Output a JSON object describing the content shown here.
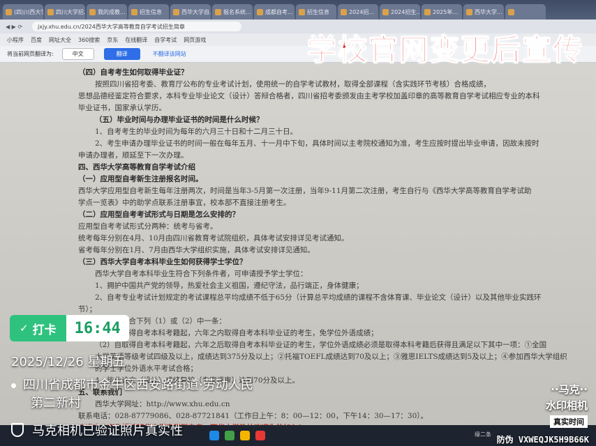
{
  "browser": {
    "tabs": [
      "(四)川西大学",
      "四川大学招...",
      "我的成教...",
      "招生信息",
      "西华大学自...",
      "报名系统...",
      "成都自考...",
      "招生信息",
      "2024招...",
      "2024招生...",
      "2025年...",
      "西华大学...",
      ""
    ],
    "url": "jxjy.xhu.edu.cn/2024西华大学高等教育自学考试招生简章",
    "bookmarks": [
      "小程序",
      "百度",
      "网址大全",
      "360搜索",
      "京东",
      "在线翻译",
      "自学考试",
      "网页游戏"
    ]
  },
  "translate_bar": {
    "label": "将当前网页翻译为:",
    "lang": "中文",
    "button": "翻译",
    "link": "不翻译该网站"
  },
  "overlay": {
    "headline": "学校官网变更后宣传",
    "checkin_label": "打卡",
    "time": "16:44",
    "date": "2025/12/26  星期五",
    "location_line1": "四川省成都市金牛区西安路街道·劳动人民",
    "location_line2": "第二新村",
    "verify": "马克相机已验证照片真实性",
    "watermark_line1": "··马克··",
    "watermark_line2": "水印相机",
    "watermark_badge": "真实时间",
    "anti_fake": "防伪 VXWEQJK5H9B66K"
  },
  "document": {
    "lines": [
      {
        "t": "（四）自考考生如何取得毕业证？",
        "c": "h"
      },
      {
        "t": "按照四川省招考委、教育厅公布的专业考试计划，使用统一的自学考试教材，取得全部课程（含实践环节考核）合格成绩，",
        "c": "ind"
      },
      {
        "t": "思想品德经鉴定符合要求，本科专业毕业论文（设计）答辩合格者，四川省招考委颁发由主考学校加盖印章的高等教育自学考试相应专业的本科",
        "c": ""
      },
      {
        "t": "毕业证书，国家承认学历。",
        "c": ""
      },
      {
        "t": "（五）毕业时间与办理毕业证书的时间是什么时候？",
        "c": "h ind"
      },
      {
        "t": "1、自考考生的毕业时间为每年的六月三十日和十二月三十日。",
        "c": "ind"
      },
      {
        "t": "2、考生申请办理毕业证书的时间一般在每年五月、十一月中下旬，具体时间以主考院校通知为准，考生应按时提出毕业申请，因故未按时",
        "c": "ind"
      },
      {
        "t": "申请办理者，顺延至下一次办理。",
        "c": ""
      },
      {
        "t": "四、西华大学高等教育自学考试介绍",
        "c": "h"
      },
      {
        "t": "（一）应用型自考新生注册报名时间。",
        "c": "h"
      },
      {
        "t": "西华大学应用型自考新生每年注册两次，时间是当年3-5月第一次注册，当年9-11月第二次注册，考生自行与《西华大学高等教育自学考试助",
        "c": ""
      },
      {
        "t": "学点一览表》中的助学点联系注册事宜，校本部不直接注册考生。",
        "c": ""
      },
      {
        "t": "（二）应用型自考考试形式与日期是怎么安排的？",
        "c": "h"
      },
      {
        "t": "应用型自考考试形式分两种：统考与省考。",
        "c": ""
      },
      {
        "t": "统考每年分别在4月、10月由四川省教育考试院组织，具体考试安排详见考试通知。",
        "c": ""
      },
      {
        "t": "省考每年分别在1月、7月由西华大学组织实施，具体考试安排详见通知。",
        "c": ""
      },
      {
        "t": "（三）西华大学自考本科毕业生如何获得学士学位？",
        "c": "h"
      },
      {
        "t": "西华大学自考本科毕业生符合下列条件者，可申请授予学士学位：",
        "c": "ind"
      },
      {
        "t": "1、拥护中国共产党的领导，热爱社会主义祖国，遵纪守法，品行端正，身体健康；",
        "c": "ind"
      },
      {
        "t": "2、自考专业考试计划规定的考试课程总平均成绩不低于65分（计算总平均成绩的课程不含体育课、毕业论文（设计）以及其他毕业实践环",
        "c": "ind"
      },
      {
        "t": "节）；",
        "c": ""
      },
      {
        "t": "3、必须符合下列（1）或（2）中一条：",
        "c": "ind"
      },
      {
        "t": "（1）自取得自考本科考籍起，六年之内取得自考本科毕业证的考生，免学位外语成绩；",
        "c": "ind"
      },
      {
        "t": "（2）自取得自考本科考籍起，六年之后取得自考本科毕业证的考生，学位外语成绩必须是取得本科考籍后获得且满足以下其中一项：①全国",
        "c": "ind"
      },
      {
        "t": "大学英语等级考试四级及以上，成绩达到375分及以上；②托福TOEFL成绩达到70及以上；③雅思IELTS成绩达到5及以上；④参加西华大学组织",
        "c": "ind"
      },
      {
        "t": "的学士学位外语水平考试合格；",
        "c": "ind"
      },
      {
        "t": "4、毕业论文（设计）成绩复核（专家评审）达到70分及以上。",
        "c": "ind"
      },
      {
        "t": "五、联系我们",
        "c": "h"
      },
      {
        "t": "西华大学网址：http://www.xhu.edu.cn",
        "c": "ind"
      },
      {
        "t": "联系电话：028-87779086、028-87721841（工作日上午：8：00—12：00，下午14：30—17：30）。",
        "c": ""
      },
      {
        "t": "欢迎广大考生报读西华大学应用型自考，西华大学热忱欢迎你的加入！",
        "c": "red"
      }
    ]
  },
  "taskbar": {
    "tray": "缘二条"
  }
}
